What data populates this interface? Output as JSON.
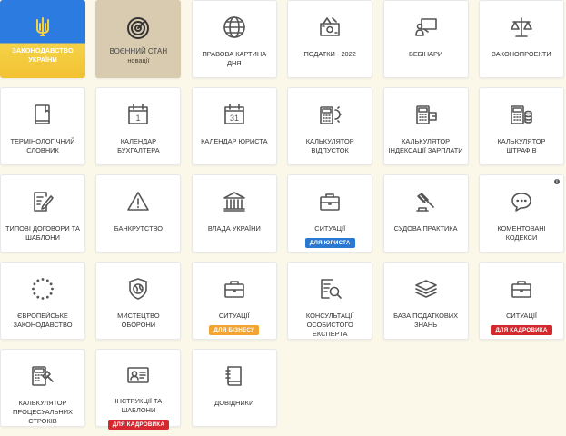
{
  "colors": {
    "badge_blue": "#2a78d2",
    "badge_orange": "#f2a533",
    "badge_red": "#d4282f"
  },
  "tiles": [
    {
      "label": "ЗАКОНОДАВСТВО УКРАЇНИ",
      "icon": "trident-icon"
    },
    {
      "label": "ВОЄННИЙ СТАН",
      "sub": "новації",
      "icon": "target-icon"
    },
    {
      "label": "ПРАВОВА КАРТИНА ДНЯ",
      "icon": "globe-icon"
    },
    {
      "label": "ПОДАТКИ - 2022",
      "icon": "tax-money-icon"
    },
    {
      "label": "ВЕБІНАРИ",
      "icon": "presenter-icon"
    },
    {
      "label": "ЗАКОНОПРОЕКТИ",
      "icon": "scales-icon"
    },
    {
      "label": "ТЕРМІНОЛОГІЧНИЙ СЛОВНИК",
      "icon": "book-icon"
    },
    {
      "label": "КАЛЕНДАР БУХГАЛТЕРА",
      "icon": "calendar-1-icon",
      "num": "1"
    },
    {
      "label": "КАЛЕНДАР ЮРИСТА",
      "icon": "calendar-31-icon",
      "num": "31"
    },
    {
      "label": "КАЛЬКУЛЯТОР ВІДПУСТОК",
      "icon": "calculator-sun-icon"
    },
    {
      "label": "КАЛЬКУЛЯТОР ІНДЕКСАЦІЇ ЗАРПЛАТИ",
      "icon": "calculator-wallet-icon"
    },
    {
      "label": "КАЛЬКУЛЯТОР ШТРАФІВ",
      "icon": "calculator-coins-icon"
    },
    {
      "label": "ТИПОВІ ДОГОВОРИ ТА ШАБЛОНИ",
      "icon": "document-pen-icon"
    },
    {
      "label": "БАНКРУТСТВО",
      "icon": "warning-icon"
    },
    {
      "label": "ВЛАДА УКРАЇНИ",
      "icon": "government-building-icon"
    },
    {
      "label": "СИТУАЦІЇ",
      "icon": "briefcase-icon",
      "badge": "ДЛЯ ЮРИСТА",
      "badge_color": "badge_blue"
    },
    {
      "label": "СУДОВА ПРАКТИКА",
      "icon": "gavel-icon"
    },
    {
      "label": "КОМЕНТОВАНІ КОДЕКСИ",
      "icon": "speech-bubble-icon",
      "info": "i"
    },
    {
      "label": "ЄВРОПЕЙСЬКЕ ЗАКОНОДАВСТВО",
      "icon": "eu-stars-icon"
    },
    {
      "label": "МИСТЕЦТВО ОБОРОНИ",
      "icon": "shield-globe-icon"
    },
    {
      "label": "СИТУАЦІЇ",
      "icon": "briefcase-icon",
      "badge": "ДЛЯ БІЗНЕСУ",
      "badge_color": "badge_orange"
    },
    {
      "label": "КОНСУЛЬТАЦІЇ ОСОБИСТОГО ЕКСПЕРТА",
      "icon": "document-magnifier-icon"
    },
    {
      "label": "БАЗА ПОДАТКОВИХ ЗНАНЬ",
      "icon": "layers-icon"
    },
    {
      "label": "СИТУАЦІЇ",
      "icon": "briefcase-icon",
      "badge": "ДЛЯ КАДРОВИКА",
      "badge_color": "badge_red"
    },
    {
      "label": "КАЛЬКУЛЯТОР ПРОЦЕСУАЛЬНИХ СТРОКІВ",
      "icon": "calculator-gavel-icon"
    },
    {
      "label": "ІНСТРУКЦІЇ ТА ШАБЛОНИ",
      "icon": "id-card-icon",
      "badge": "ДЛЯ КАДРОВИКА",
      "badge_color": "badge_red"
    },
    {
      "label": "ДОВІДНИКИ",
      "icon": "handbook-icon"
    }
  ]
}
